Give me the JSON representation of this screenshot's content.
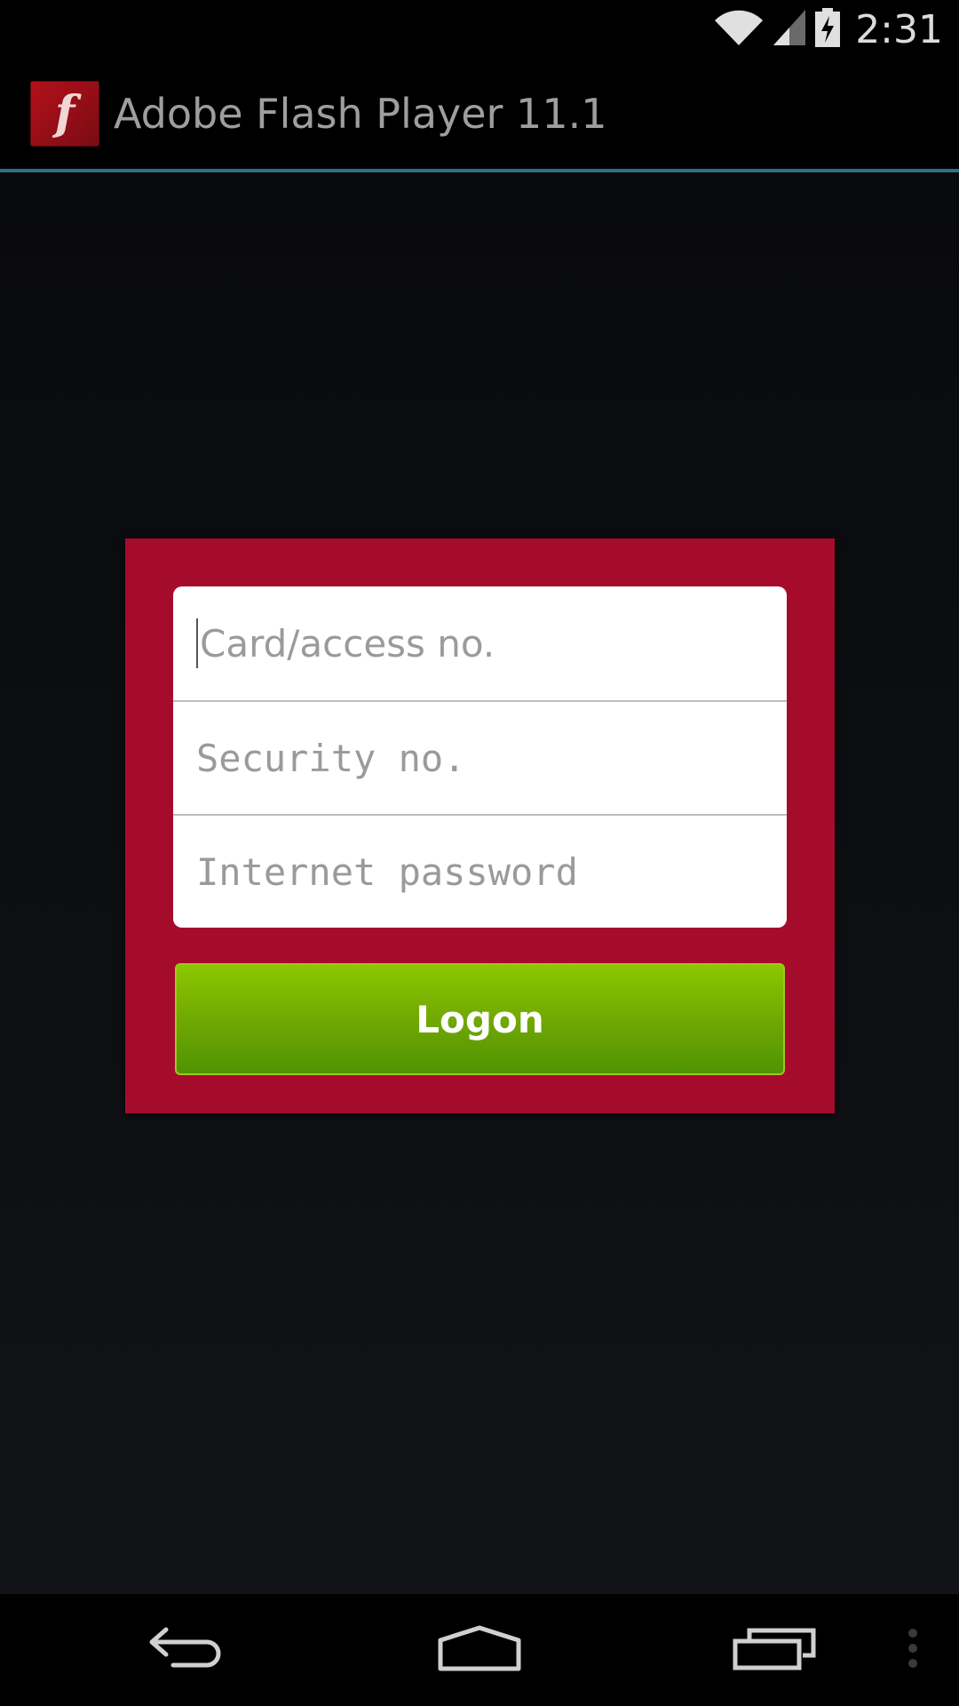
{
  "status_bar": {
    "time": "2:31",
    "icons": [
      "wifi-icon",
      "signal-icon",
      "battery-charging-icon"
    ]
  },
  "action_bar": {
    "app_icon_glyph": "f",
    "title": "Adobe Flash Player 11.1",
    "divider_color": "#2f6f84"
  },
  "login_form": {
    "card_color": "#a50b2b",
    "fields": [
      {
        "placeholder": "Card/access no.",
        "value": ""
      },
      {
        "placeholder": "Security no.",
        "value": ""
      },
      {
        "placeholder": "Internet password",
        "value": ""
      }
    ],
    "logon_label": "Logon",
    "button_color": "#6ea603"
  },
  "nav_bar": {
    "buttons": [
      "back-icon",
      "home-icon",
      "recent-apps-icon",
      "menu-overflow-icon"
    ]
  }
}
